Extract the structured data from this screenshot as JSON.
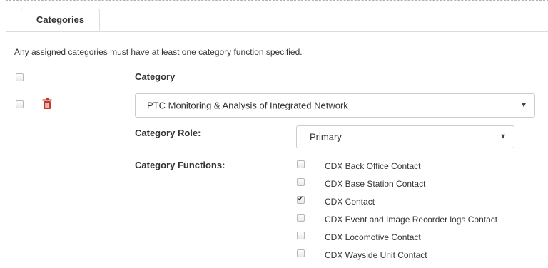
{
  "tabs": [
    {
      "label": "Categories"
    }
  ],
  "notice": "Any assigned categories must have at least one category function specified.",
  "header": {
    "category_label": "Category"
  },
  "row": {
    "category_value": "PTC Monitoring & Analysis of Integrated Network",
    "role_label": "Category Role:",
    "role_value": "Primary",
    "functions_label": "Category Functions:"
  },
  "functions": [
    {
      "label": "CDX Back Office Contact",
      "checked": false
    },
    {
      "label": "CDX Base Station Contact",
      "checked": false
    },
    {
      "label": "CDX Contact",
      "checked": true
    },
    {
      "label": "CDX Event and Image Recorder logs Contact",
      "checked": false
    },
    {
      "label": "CDX Locomotive Contact",
      "checked": false
    },
    {
      "label": "CDX Wayside Unit Contact",
      "checked": false
    }
  ],
  "colors": {
    "trash": "#c0392b",
    "border": "#cccccc",
    "text": "#333333"
  },
  "icons": {
    "trash": "trash-icon",
    "dropdown": "chevron-down-icon"
  }
}
